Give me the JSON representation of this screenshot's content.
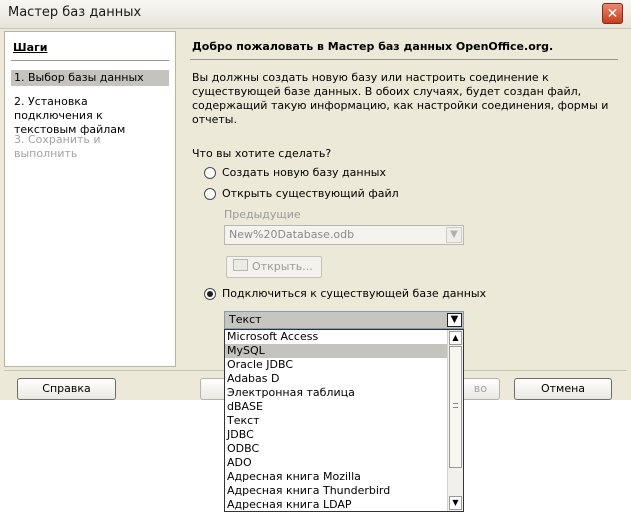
{
  "window": {
    "title": "Мастер баз данных",
    "close_glyph": "✕"
  },
  "sidebar": {
    "title": "Шаги",
    "steps": [
      {
        "label": "1. Выбор базы данных"
      },
      {
        "label": "2. Установка подключения к текстовым файлам"
      },
      {
        "label": "3. Сохранить и выполнить"
      }
    ]
  },
  "content": {
    "title": "Добро пожаловать в Мастер баз данных OpenOffice.org.",
    "description": "Вы должны создать новую базу или настроить соединение к существующей базе данных. В обоих случаях, будет создан файл, содержащий такую информацию, как настройки соединения, формы и отчеты.",
    "question": "Что вы хотите сделать?",
    "options": {
      "create": "Создать новую базу данных",
      "open": "Открыть существующий файл",
      "connect": "Подключиться к существующей базе данных"
    },
    "selected_option": "connect",
    "previous_label": "Предыдущие",
    "previous_value": "New%20Database.odb",
    "open_button": "Открыть..."
  },
  "db_type": {
    "value": "Текст",
    "options": [
      "Microsoft Access",
      "MySQL",
      "Oracle JDBC",
      "Adabas D",
      "Электронная таблица",
      "dBASE",
      "Текст",
      "JDBC",
      "ODBC",
      "ADO",
      "Адресная книга Mozilla",
      "Адресная книга Thunderbird",
      "Адресная книга LDAP"
    ],
    "highlighted": "MySQL"
  },
  "buttons": {
    "help": "Справка",
    "hidden_partial": "во",
    "cancel": "Отмена"
  },
  "icons": {
    "close": "close-icon",
    "folder": "folder-icon",
    "dropdown": "chevron-down-icon"
  }
}
